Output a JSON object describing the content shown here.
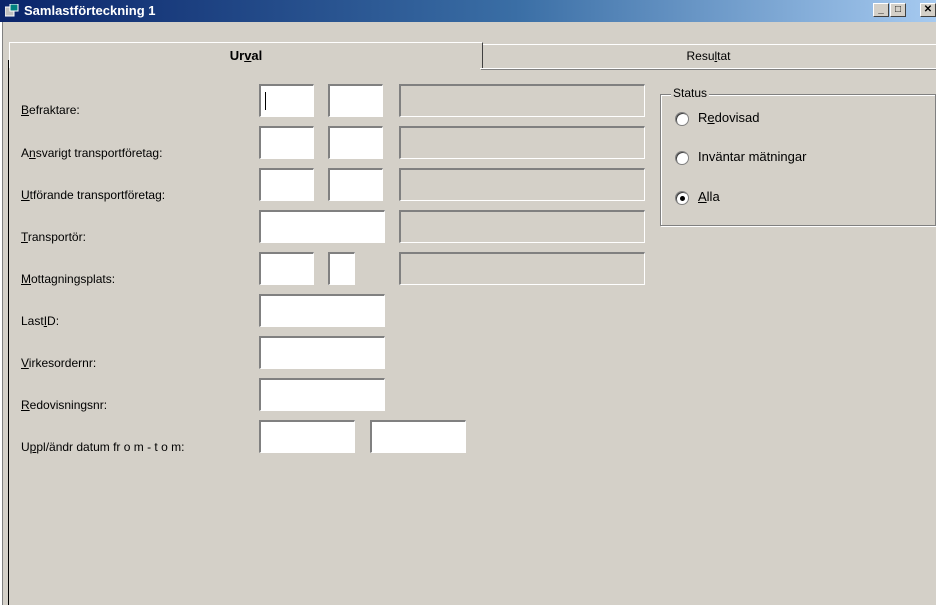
{
  "window": {
    "title": "Samlastförteckning 1"
  },
  "tabs": {
    "urval": "Urval",
    "resultat": "Resultat"
  },
  "labels": {
    "befraktare": "Befraktare:",
    "ansvarigt": "Ansvarigt transportföretag:",
    "utforande": "Utförande transportföretag:",
    "transportor": "Transportör:",
    "mottagningsplats": "Mottagningsplats:",
    "lastid": "LastID:",
    "virkesordernr": "Virkesordernr:",
    "redovisningsnr": "Redovisningsnr:",
    "datum": "Uppl/ändr datum fr o m - t o m:"
  },
  "status": {
    "title": "Status",
    "options": [
      "Redovisad",
      "Inväntar mätningar",
      "Alla"
    ],
    "selected": "Alla"
  },
  "icons": {
    "app": "app-icon",
    "minimize": "minimize-icon",
    "maximize": "maximize-icon",
    "close": "close-icon"
  }
}
